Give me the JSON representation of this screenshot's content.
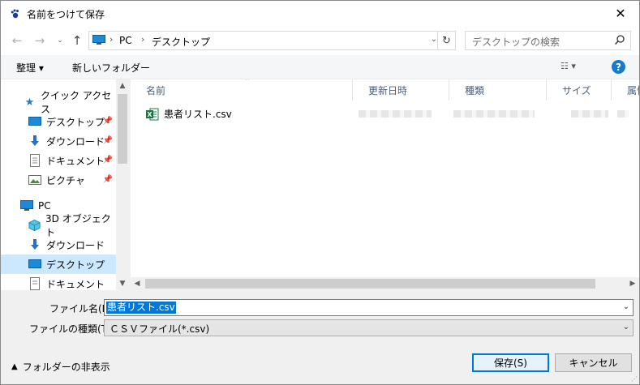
{
  "window": {
    "title": "名前をつけて保存",
    "close": "✕"
  },
  "nav": {
    "back": "←",
    "forward": "→",
    "up": "↑",
    "address_segments": [
      "PC",
      "デスクトップ"
    ],
    "search_placeholder": "デスクトップの検索"
  },
  "toolbar": {
    "organize": "整理 ▾",
    "new_folder": "新しいフォルダー",
    "view": "☷ ▾",
    "help": "?"
  },
  "sidebar": {
    "items": [
      {
        "label": "クイック アクセス",
        "icon": "star-icon"
      },
      {
        "label": "デスクトップ",
        "icon": "desktop-icon",
        "pinned": true
      },
      {
        "label": "ダウンロード",
        "icon": "download-icon",
        "pinned": true
      },
      {
        "label": "ドキュメント",
        "icon": "document-icon",
        "pinned": true
      },
      {
        "label": "ピクチャ",
        "icon": "picture-icon",
        "pinned": true
      },
      {
        "label": "PC",
        "icon": "pc-icon"
      },
      {
        "label": "3D オブジェクト",
        "icon": "cube-icon"
      },
      {
        "label": "ダウンロード",
        "icon": "download-icon"
      },
      {
        "label": "デスクトップ",
        "icon": "desktop-icon",
        "selected": true
      },
      {
        "label": "ドキュメント",
        "icon": "document-icon"
      }
    ]
  },
  "columns": [
    "名前",
    "更新日時",
    "種類",
    "サイズ",
    "属性"
  ],
  "files": [
    {
      "name": "患者リスト.csv",
      "icon": "excel-csv-icon"
    }
  ],
  "form": {
    "filename_label": "ファイル名(N):",
    "filename_value": "患者リスト.csv",
    "filetype_label": "ファイルの種類(T):",
    "filetype_value": "ＣＳＶファイル(*.csv)",
    "hide_folders": "フォルダーの非表示",
    "save": "保存(S)",
    "cancel": "キャンセル"
  },
  "colors": {
    "accent": "#0078d7",
    "selection": "#cce8ff",
    "help": "#1979ca",
    "excel": "#1d7344"
  }
}
